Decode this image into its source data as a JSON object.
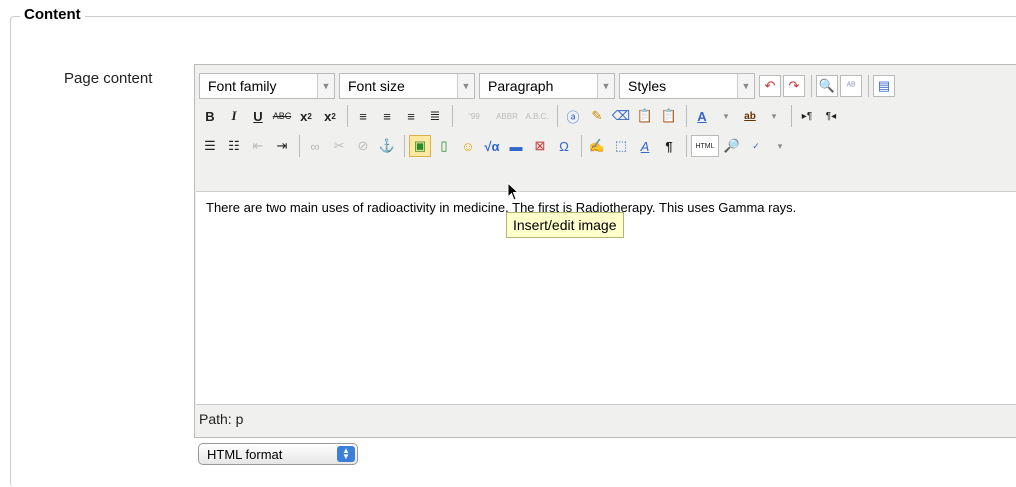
{
  "legend": "Content",
  "field_label": "Page content",
  "toolbar": {
    "font_family": "Font family",
    "font_size": "Font size",
    "paragraph": "Paragraph",
    "styles": "Styles"
  },
  "content_text": "There are two main uses of radioactivity in medicine. The first is Radiotherapy. This uses Gamma rays.",
  "tooltip": "Insert/edit image",
  "path_label": "Path: p",
  "format_select": "HTML format"
}
